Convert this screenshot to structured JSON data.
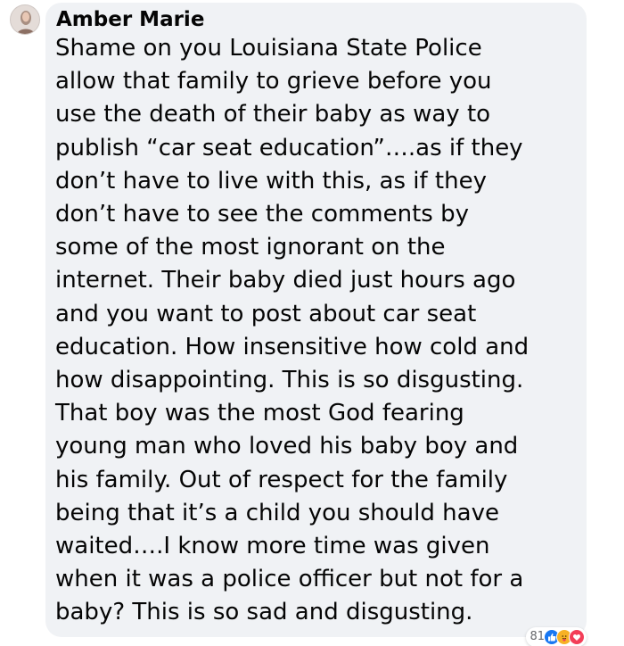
{
  "comment": {
    "author": "Amber Marie",
    "lines": [
      "Shame on you Louisiana State Police",
      "allow that family to grieve before you",
      "use the death of their baby as way to",
      "publish “car seat education”….as if they",
      "don’t have to live with this, as if they",
      "don’t have to see the comments by",
      "some of the most ignorant on the",
      "internet. Their baby died just hours ago",
      "and you want to post about car seat",
      "education. How insensitive how cold and",
      "how disappointing. This is so disgusting.",
      "That boy was the most God fearing",
      "young man who loved his baby boy and",
      "his family. Out of respect for the family",
      "being that it’s a child you should have",
      "waited….I know more time was given",
      "when it was a police officer but not for a",
      "baby? This is so sad and disgusting."
    ],
    "reactions": {
      "count": "81",
      "icons": [
        "like-icon",
        "care-icon",
        "love-icon"
      ]
    }
  },
  "colors": {
    "bubble_background": "#f0f2f5",
    "text": "#050505",
    "like": "#1877f2",
    "care": "#f7b125",
    "love": "#f33e58",
    "count_text": "#65676b"
  }
}
